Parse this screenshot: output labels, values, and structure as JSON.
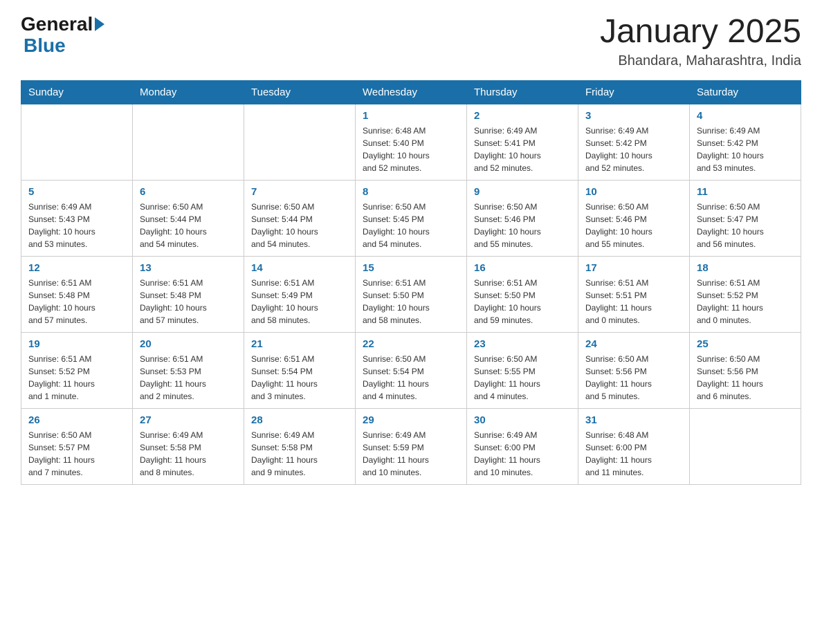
{
  "header": {
    "logo_general": "General",
    "logo_blue": "Blue",
    "month_title": "January 2025",
    "location": "Bhandara, Maharashtra, India"
  },
  "days_of_week": [
    "Sunday",
    "Monday",
    "Tuesday",
    "Wednesday",
    "Thursday",
    "Friday",
    "Saturday"
  ],
  "weeks": [
    [
      {
        "day": "",
        "info": ""
      },
      {
        "day": "",
        "info": ""
      },
      {
        "day": "",
        "info": ""
      },
      {
        "day": "1",
        "info": "Sunrise: 6:48 AM\nSunset: 5:40 PM\nDaylight: 10 hours\nand 52 minutes."
      },
      {
        "day": "2",
        "info": "Sunrise: 6:49 AM\nSunset: 5:41 PM\nDaylight: 10 hours\nand 52 minutes."
      },
      {
        "day": "3",
        "info": "Sunrise: 6:49 AM\nSunset: 5:42 PM\nDaylight: 10 hours\nand 52 minutes."
      },
      {
        "day": "4",
        "info": "Sunrise: 6:49 AM\nSunset: 5:42 PM\nDaylight: 10 hours\nand 53 minutes."
      }
    ],
    [
      {
        "day": "5",
        "info": "Sunrise: 6:49 AM\nSunset: 5:43 PM\nDaylight: 10 hours\nand 53 minutes."
      },
      {
        "day": "6",
        "info": "Sunrise: 6:50 AM\nSunset: 5:44 PM\nDaylight: 10 hours\nand 54 minutes."
      },
      {
        "day": "7",
        "info": "Sunrise: 6:50 AM\nSunset: 5:44 PM\nDaylight: 10 hours\nand 54 minutes."
      },
      {
        "day": "8",
        "info": "Sunrise: 6:50 AM\nSunset: 5:45 PM\nDaylight: 10 hours\nand 54 minutes."
      },
      {
        "day": "9",
        "info": "Sunrise: 6:50 AM\nSunset: 5:46 PM\nDaylight: 10 hours\nand 55 minutes."
      },
      {
        "day": "10",
        "info": "Sunrise: 6:50 AM\nSunset: 5:46 PM\nDaylight: 10 hours\nand 55 minutes."
      },
      {
        "day": "11",
        "info": "Sunrise: 6:50 AM\nSunset: 5:47 PM\nDaylight: 10 hours\nand 56 minutes."
      }
    ],
    [
      {
        "day": "12",
        "info": "Sunrise: 6:51 AM\nSunset: 5:48 PM\nDaylight: 10 hours\nand 57 minutes."
      },
      {
        "day": "13",
        "info": "Sunrise: 6:51 AM\nSunset: 5:48 PM\nDaylight: 10 hours\nand 57 minutes."
      },
      {
        "day": "14",
        "info": "Sunrise: 6:51 AM\nSunset: 5:49 PM\nDaylight: 10 hours\nand 58 minutes."
      },
      {
        "day": "15",
        "info": "Sunrise: 6:51 AM\nSunset: 5:50 PM\nDaylight: 10 hours\nand 58 minutes."
      },
      {
        "day": "16",
        "info": "Sunrise: 6:51 AM\nSunset: 5:50 PM\nDaylight: 10 hours\nand 59 minutes."
      },
      {
        "day": "17",
        "info": "Sunrise: 6:51 AM\nSunset: 5:51 PM\nDaylight: 11 hours\nand 0 minutes."
      },
      {
        "day": "18",
        "info": "Sunrise: 6:51 AM\nSunset: 5:52 PM\nDaylight: 11 hours\nand 0 minutes."
      }
    ],
    [
      {
        "day": "19",
        "info": "Sunrise: 6:51 AM\nSunset: 5:52 PM\nDaylight: 11 hours\nand 1 minute."
      },
      {
        "day": "20",
        "info": "Sunrise: 6:51 AM\nSunset: 5:53 PM\nDaylight: 11 hours\nand 2 minutes."
      },
      {
        "day": "21",
        "info": "Sunrise: 6:51 AM\nSunset: 5:54 PM\nDaylight: 11 hours\nand 3 minutes."
      },
      {
        "day": "22",
        "info": "Sunrise: 6:50 AM\nSunset: 5:54 PM\nDaylight: 11 hours\nand 4 minutes."
      },
      {
        "day": "23",
        "info": "Sunrise: 6:50 AM\nSunset: 5:55 PM\nDaylight: 11 hours\nand 4 minutes."
      },
      {
        "day": "24",
        "info": "Sunrise: 6:50 AM\nSunset: 5:56 PM\nDaylight: 11 hours\nand 5 minutes."
      },
      {
        "day": "25",
        "info": "Sunrise: 6:50 AM\nSunset: 5:56 PM\nDaylight: 11 hours\nand 6 minutes."
      }
    ],
    [
      {
        "day": "26",
        "info": "Sunrise: 6:50 AM\nSunset: 5:57 PM\nDaylight: 11 hours\nand 7 minutes."
      },
      {
        "day": "27",
        "info": "Sunrise: 6:49 AM\nSunset: 5:58 PM\nDaylight: 11 hours\nand 8 minutes."
      },
      {
        "day": "28",
        "info": "Sunrise: 6:49 AM\nSunset: 5:58 PM\nDaylight: 11 hours\nand 9 minutes."
      },
      {
        "day": "29",
        "info": "Sunrise: 6:49 AM\nSunset: 5:59 PM\nDaylight: 11 hours\nand 10 minutes."
      },
      {
        "day": "30",
        "info": "Sunrise: 6:49 AM\nSunset: 6:00 PM\nDaylight: 11 hours\nand 10 minutes."
      },
      {
        "day": "31",
        "info": "Sunrise: 6:48 AM\nSunset: 6:00 PM\nDaylight: 11 hours\nand 11 minutes."
      },
      {
        "day": "",
        "info": ""
      }
    ]
  ]
}
